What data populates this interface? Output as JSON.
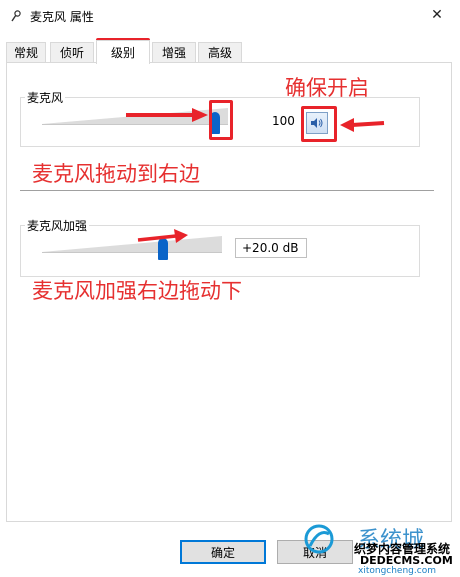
{
  "window": {
    "title": "麦克风 属性",
    "close_glyph": "✕"
  },
  "tabs": [
    {
      "label": "常规"
    },
    {
      "label": "侦听"
    },
    {
      "label": "级别"
    },
    {
      "label": "增强"
    },
    {
      "label": "高级"
    }
  ],
  "microphone": {
    "label": "麦克风",
    "value": "100",
    "level_fraction": 1.0
  },
  "boost": {
    "label": "麦克风加强",
    "value": "+20.0 dB",
    "level_fraction": 0.67
  },
  "annotations": {
    "ensure_on": "确保开启",
    "drag_right": "麦克风拖动到右边",
    "boost_drag": "麦克风加强右边拖动下"
  },
  "buttons": {
    "ok": "确定",
    "cancel": "取消"
  },
  "watermark": {
    "line1": "系统城",
    "line2": "织梦内容管理系统",
    "line3": "DEDECMS.COM",
    "line4": "xitongcheng.com"
  },
  "colors": {
    "accent": "#0a64c8",
    "annotation": "#e63030",
    "highlight": "#e8232a"
  }
}
